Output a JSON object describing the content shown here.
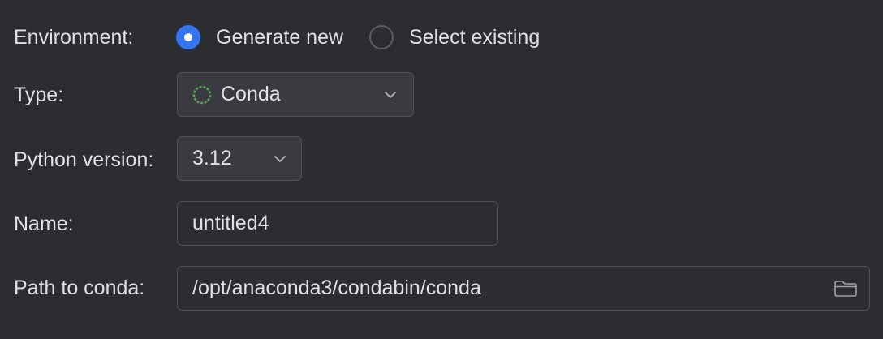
{
  "environment": {
    "label": "Environment:",
    "options": [
      {
        "label": "Generate new",
        "selected": true
      },
      {
        "label": "Select existing",
        "selected": false
      }
    ]
  },
  "type": {
    "label": "Type:",
    "value": "Conda",
    "icon": "conda-icon"
  },
  "python_version": {
    "label": "Python version:",
    "value": "3.12"
  },
  "name": {
    "label": "Name:",
    "value": "untitled4"
  },
  "path_to_conda": {
    "label": "Path to conda:",
    "value": "/opt/anaconda3/condabin/conda",
    "icon": "folder-icon"
  },
  "colors": {
    "background": "#2b2d30",
    "accent": "#3574f0",
    "text": "#dfe1e5",
    "border": "#4e5157",
    "conda_green": "#5a9e5a"
  }
}
